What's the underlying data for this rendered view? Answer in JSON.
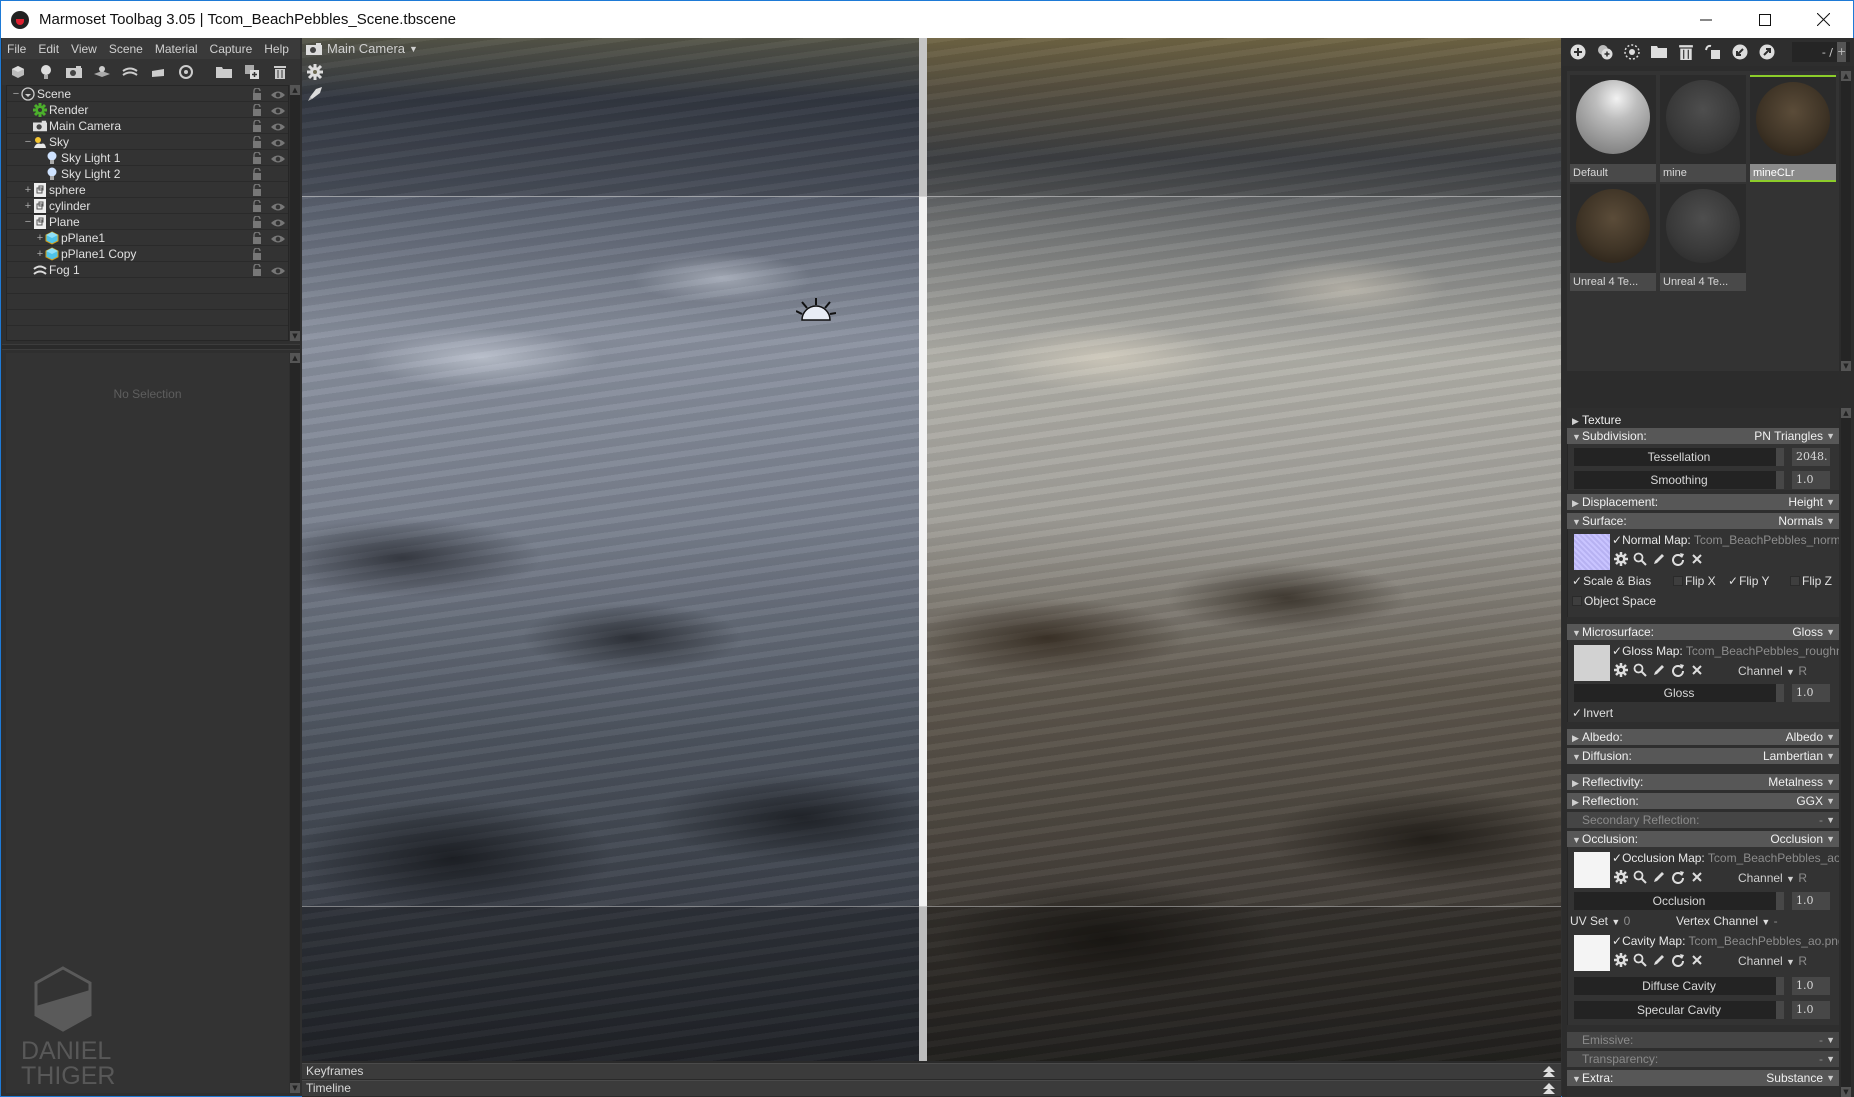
{
  "window": {
    "title": "Marmoset Toolbag 3.05  |  Tcom_BeachPebbles_Scene.tbscene",
    "controls": {
      "minimize": "—",
      "maximize": "☐",
      "close": "✕"
    }
  },
  "menu": [
    "File",
    "Edit",
    "View",
    "Scene",
    "Material",
    "Capture",
    "Help"
  ],
  "left_toolbar": {
    "icons": [
      "add-mesh-icon",
      "add-light-icon",
      "add-camera-icon",
      "add-shadow-catcher-icon",
      "add-fog-icon",
      "add-turntable-icon",
      "add-audio-icon",
      "folder-icon",
      "duplicate-icon",
      "trash-icon"
    ]
  },
  "scene_tree": {
    "items": [
      {
        "label": "Scene",
        "icon": "scene-icon",
        "depth": 0,
        "expander": "−",
        "visible": true
      },
      {
        "label": "Render",
        "icon": "render-gear-icon",
        "depth": 1,
        "expander": "",
        "visible": true
      },
      {
        "label": "Main Camera",
        "icon": "camera-icon",
        "depth": 1,
        "expander": "",
        "visible": true
      },
      {
        "label": "Sky",
        "icon": "sky-icon",
        "depth": 1,
        "expander": "−",
        "visible": true
      },
      {
        "label": "Sky Light 1",
        "icon": "light-bulb-icon",
        "depth": 2,
        "expander": "",
        "visible": true
      },
      {
        "label": "Sky Light 2",
        "icon": "light-bulb-icon",
        "depth": 2,
        "expander": "",
        "visible": false
      },
      {
        "label": "sphere",
        "icon": "mesh-icon",
        "depth": 1,
        "expander": "+",
        "visible": false
      },
      {
        "label": "cylinder",
        "icon": "mesh-icon",
        "depth": 1,
        "expander": "+",
        "visible": true
      },
      {
        "label": "Plane",
        "icon": "mesh-icon",
        "depth": 1,
        "expander": "−",
        "visible": true
      },
      {
        "label": "pPlane1",
        "icon": "submesh-cube-icon",
        "depth": 2,
        "expander": "+",
        "visible": true
      },
      {
        "label": "pPlane1 Copy",
        "icon": "submesh-cube-icon",
        "depth": 2,
        "expander": "+",
        "visible": false
      },
      {
        "label": "Fog 1",
        "icon": "fog-icon",
        "depth": 1,
        "expander": "",
        "visible": true
      }
    ]
  },
  "properties": {
    "empty_text": "No Selection"
  },
  "watermark": {
    "line1": "DANIEL",
    "line2": "THIGER"
  },
  "viewport": {
    "camera_label": "Main Camera",
    "tools": [
      "settings-gear-icon",
      "rocket-icon"
    ]
  },
  "timeline": {
    "keyframes_label": "Keyframes",
    "timeline_label": "Timeline"
  },
  "material_library": {
    "counter": "- /",
    "counter_plus": "+",
    "toolbar_icons": [
      "add-material-icon",
      "duplicate-material-icon",
      "material-template-icon",
      "open-folder-icon",
      "delete-material-icon",
      "assign-material-icon",
      "import-material-icon",
      "export-material-icon"
    ],
    "materials": [
      {
        "name": "Default",
        "selected": false,
        "tone": "default"
      },
      {
        "name": "mine",
        "selected": false,
        "tone": "gray"
      },
      {
        "name": "mineCLr",
        "selected": true,
        "tone": "brown"
      },
      {
        "name": "Unreal 4 Te...",
        "selected": false,
        "tone": "brown"
      },
      {
        "name": "Unreal 4 Te...",
        "selected": false,
        "tone": "gray"
      }
    ],
    "selected_accent": "#8ccc2a"
  },
  "material_editor": {
    "texture": {
      "label": "Texture"
    },
    "subdivision": {
      "label": "Subdivision:",
      "value": "PN Triangles",
      "tessellation": {
        "label": "Tessellation",
        "value": "2048."
      },
      "smoothing": {
        "label": "Smoothing",
        "value": "1.0"
      }
    },
    "displacement": {
      "label": "Displacement:",
      "value": "Height"
    },
    "surface": {
      "label": "Surface:",
      "value": "Normals",
      "map_label": "Normal Map:",
      "map_file": "Tcom_BeachPebbles_norm",
      "scale_bias": {
        "label": "Scale & Bias",
        "checked": true
      },
      "flip_x": {
        "label": "Flip X",
        "checked": false
      },
      "flip_y": {
        "label": "Flip Y",
        "checked": true
      },
      "flip_z": {
        "label": "Flip Z",
        "checked": false
      },
      "object_space": {
        "label": "Object Space",
        "checked": false
      }
    },
    "microsurface": {
      "label": "Microsurface:",
      "value": "Gloss",
      "map_label": "Gloss Map:",
      "map_file": "Tcom_BeachPebbles_roughn",
      "channel_label": "Channel",
      "channel_value": "R",
      "gloss": {
        "label": "Gloss",
        "value": "1.0"
      },
      "invert": {
        "label": "Invert",
        "checked": true
      }
    },
    "albedo": {
      "label": "Albedo:",
      "value": "Albedo"
    },
    "diffusion": {
      "label": "Diffusion:",
      "value": "Lambertian"
    },
    "reflectivity": {
      "label": "Reflectivity:",
      "value": "Metalness"
    },
    "reflection": {
      "label": "Reflection:",
      "value": "GGX"
    },
    "secondary_reflection": {
      "label": "Secondary Reflection:",
      "value": "-"
    },
    "occlusion": {
      "label": "Occlusion:",
      "value": "Occlusion",
      "map_label": "Occlusion Map:",
      "map_file": "Tcom_BeachPebbles_ao",
      "channel_label": "Channel",
      "channel_value": "R",
      "occlusion": {
        "label": "Occlusion",
        "value": "1.0"
      },
      "uv_set_label": "UV Set",
      "uv_set_value": "0",
      "vertex_channel_label": "Vertex Channel",
      "vertex_channel_value": "-",
      "cavity_map_label": "Cavity Map:",
      "cavity_map_file": "Tcom_BeachPebbles_ao.png",
      "cavity_channel_label": "Channel",
      "cavity_channel_value": "R",
      "diffuse_cavity": {
        "label": "Diffuse Cavity",
        "value": "1.0"
      },
      "specular_cavity": {
        "label": "Specular Cavity",
        "value": "1.0"
      }
    },
    "emissive": {
      "label": "Emissive:",
      "value": "-"
    },
    "transparency": {
      "label": "Transparency:",
      "value": "-"
    },
    "extra": {
      "label": "Extra:",
      "value": "Substance"
    }
  }
}
